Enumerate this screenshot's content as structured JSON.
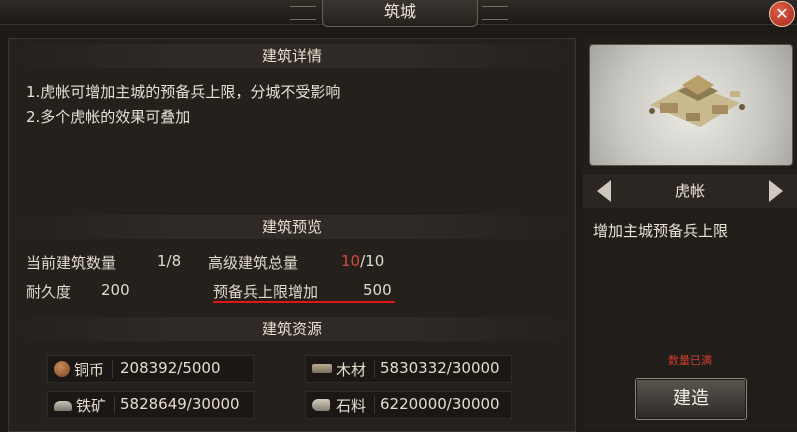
{
  "window": {
    "title": "筑城",
    "close_icon": "close-icon"
  },
  "details": {
    "header": "建筑详情",
    "lines": [
      "1.虎帐可增加主城的预备兵上限，分城不受影响",
      "2.多个虎帐的效果可叠加"
    ]
  },
  "preview": {
    "header": "建筑预览",
    "current_count_label": "当前建筑数量",
    "current_count_value": "1/8",
    "advanced_total_label": "高级建筑总量",
    "advanced_total_current": "10",
    "advanced_total_sep_max": "/10",
    "durability_label": "耐久度",
    "durability_value": "200",
    "reserve_bonus_label": "预备兵上限增加",
    "reserve_bonus_value": "500"
  },
  "resources": {
    "header": "建筑资源",
    "items": [
      {
        "icon": "copper-coin-icon",
        "label": "铜币",
        "value": "208392/5000"
      },
      {
        "icon": "wood-icon",
        "label": "木材",
        "value": "5830332/30000"
      },
      {
        "icon": "iron-ore-icon",
        "label": "铁矿",
        "value": "5828649/30000"
      },
      {
        "icon": "stone-icon",
        "label": "石料",
        "value": "6220000/30000"
      }
    ]
  },
  "side": {
    "building_name": "虎帐",
    "description": "增加主城预备兵上限",
    "status": "数量已满",
    "build_label": "建造"
  },
  "colors": {
    "accent_red": "#d14a3f",
    "underline_red": "#e11515"
  }
}
